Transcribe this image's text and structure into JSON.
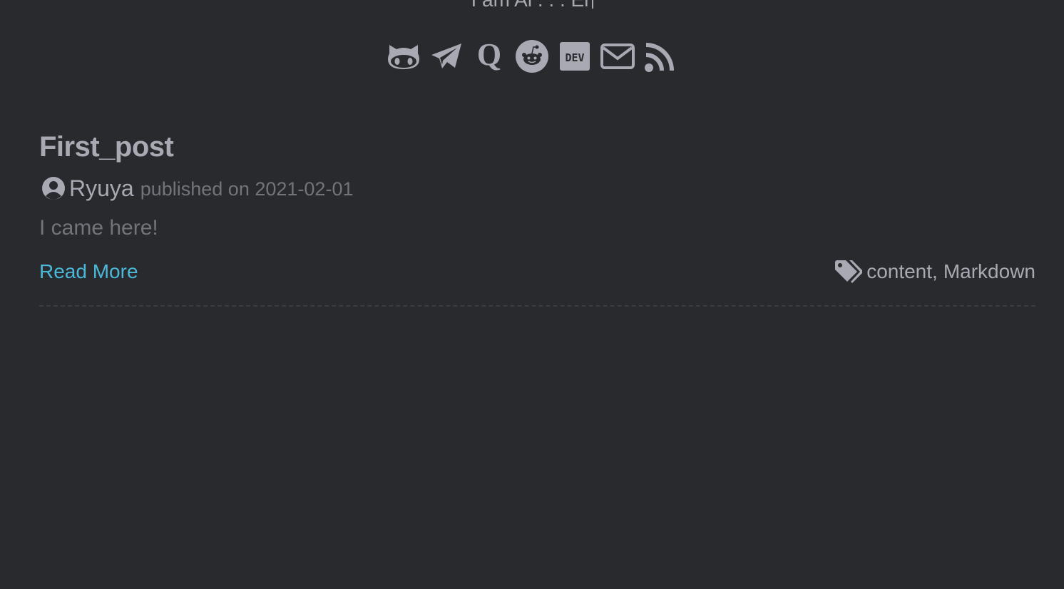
{
  "header": {
    "typed_text": "I am Al . . . Er"
  },
  "social_links": [
    {
      "name": "GitHub",
      "icon": "github-icon"
    },
    {
      "name": "Telegram",
      "icon": "telegram-icon"
    },
    {
      "name": "Quora",
      "icon": "quora-icon"
    },
    {
      "name": "Reddit",
      "icon": "reddit-icon"
    },
    {
      "name": "DEV",
      "icon": "dev-icon",
      "label": "DEV"
    },
    {
      "name": "Email",
      "icon": "email-icon"
    },
    {
      "name": "RSS",
      "icon": "rss-icon"
    }
  ],
  "post": {
    "title": "First_post",
    "author": "Ryuya",
    "published_prefix": "published on",
    "date": "2021-02-01",
    "summary": "I came here!",
    "read_more": "Read More",
    "tags": [
      "content",
      "Markdown"
    ],
    "tag_separator": ","
  },
  "colors": {
    "background": "#292a2e",
    "text": "#a9a9b3",
    "muted": "#73747b",
    "link": "#4bb8d8"
  }
}
